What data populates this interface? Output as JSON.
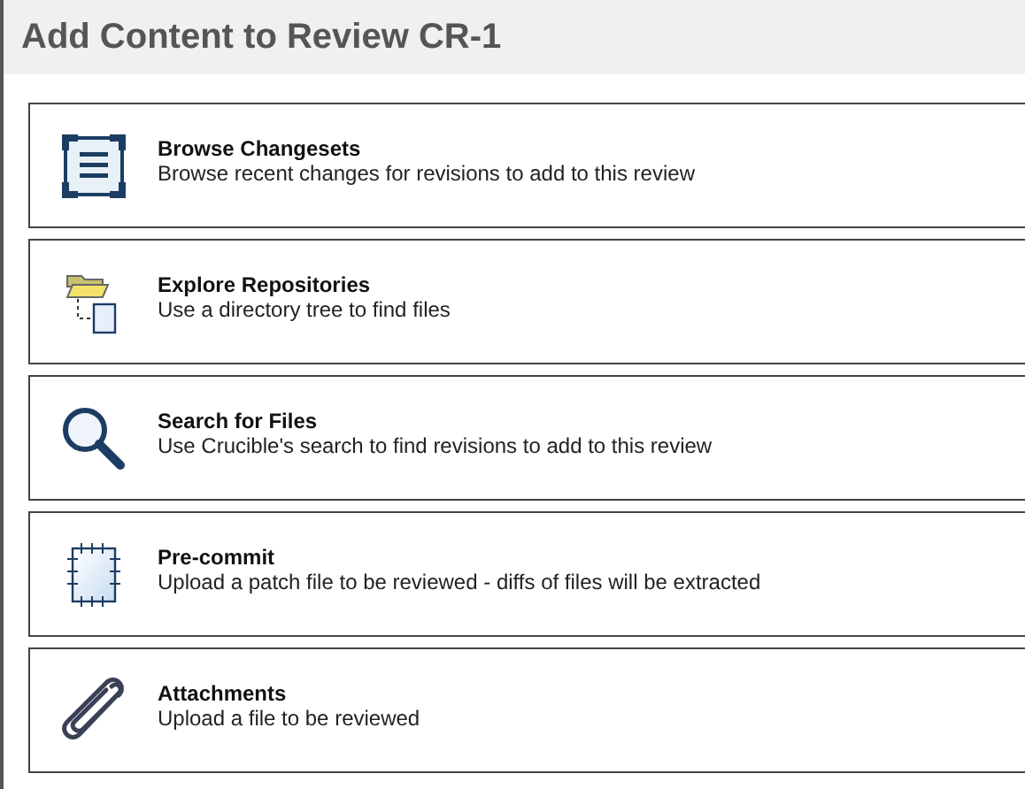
{
  "title": "Add Content to Review CR-1",
  "options": [
    {
      "kind": "changesets",
      "title": "Browse Changesets",
      "description": "Browse recent changes for revisions to add to this review"
    },
    {
      "kind": "repository",
      "title": "Explore Repositories",
      "description": "Use a directory tree to find files"
    },
    {
      "kind": "search",
      "title": "Search for Files",
      "description": "Use Crucible's search to find revisions to add to this review"
    },
    {
      "kind": "patch",
      "title": "Pre-commit",
      "description": "Upload a patch file to be reviewed - diffs of files will be extracted"
    },
    {
      "kind": "attachment",
      "title": "Attachments",
      "description": "Upload a file to be reviewed"
    }
  ]
}
